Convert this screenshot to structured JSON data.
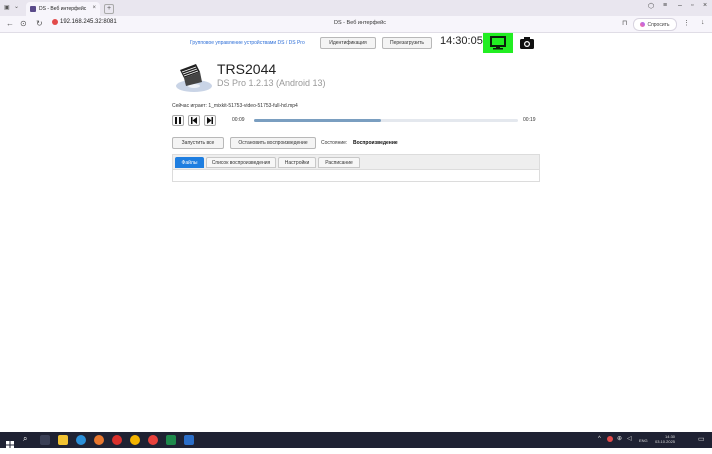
{
  "browser": {
    "tab_title": "DS - Веб интерфейс",
    "url": "192.168.245.32:8081",
    "page_title": "DS - Веб интерфейс",
    "ask_button": "Спросить"
  },
  "header": {
    "group_link": "Групповое управление устройствами DS / DS Pro",
    "identify_button": "Идентификация",
    "reboot_button": "Перезагрузить",
    "clock": "14:30:05",
    "screen_button_color": "#22ee22"
  },
  "device": {
    "name": "TRS2044",
    "version": "DS Pro 1.2.13 (Android 13)"
  },
  "player": {
    "now_playing": "Сейчас играет:  1_mixkit-51753-video-51753-full-hd.mp4",
    "current_time": "00:09",
    "total_time": "00:19",
    "progress": 0.48
  },
  "controls": {
    "start_all": "Запустить все",
    "stop_playback": "Остановить воспроизведение",
    "state_label": "Состояние:",
    "state_value": "Воспроизведение"
  },
  "tabs": {
    "files": "Файлы",
    "playlist": "Список воспроизведения",
    "settings": "Настройки",
    "schedule": "Расписание",
    "active": "files"
  },
  "taskbar": {
    "lang": "ENG",
    "time": "14:30",
    "date": "03.10.2025"
  }
}
